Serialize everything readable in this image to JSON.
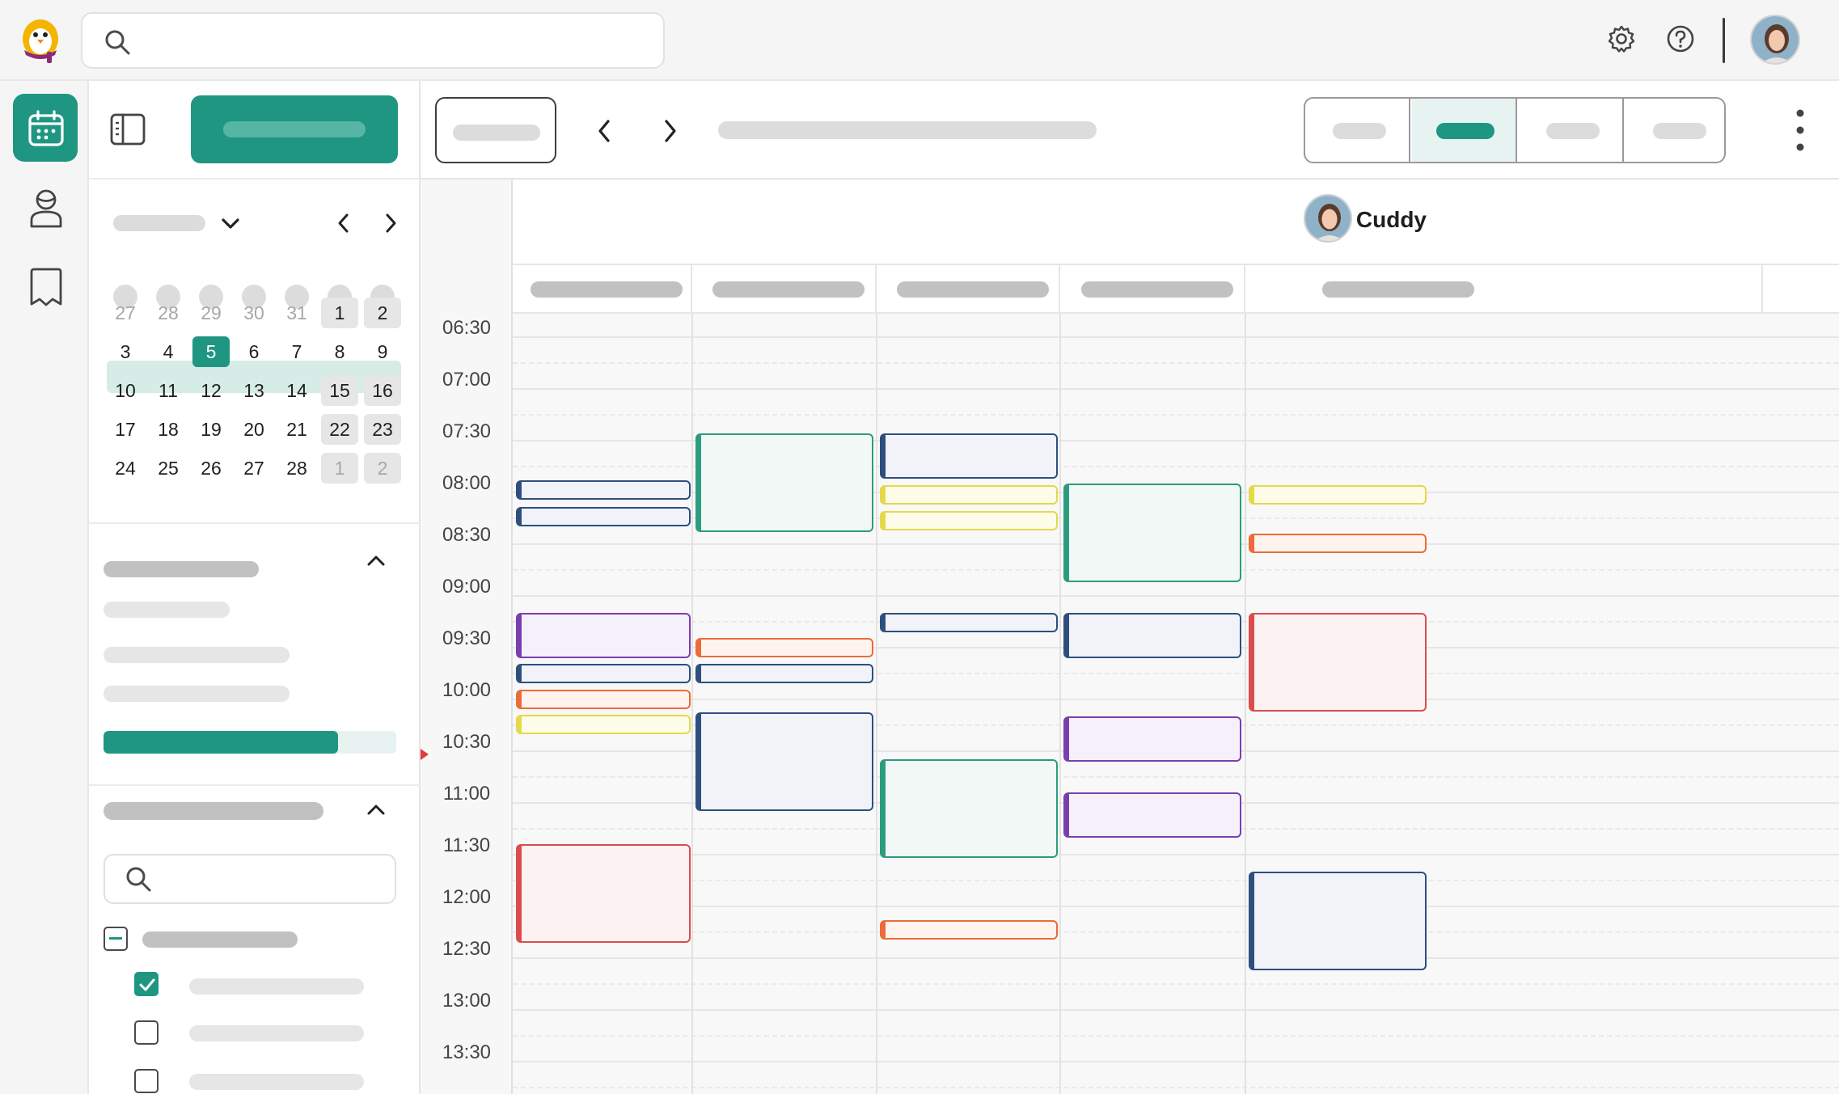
{
  "resource": {
    "name": "Dr. Cuddy"
  },
  "time_slots": [
    "06:30",
    "07:00",
    "07:30",
    "08:00",
    "08:30",
    "09:00",
    "09:30",
    "10:00",
    "10:30",
    "11:00",
    "11:30",
    "12:00",
    "12:30",
    "13:00",
    "13:30"
  ],
  "mini_calendar": {
    "weeks": [
      [
        "27",
        "28",
        "29",
        "30",
        "31",
        "1",
        "2"
      ],
      [
        "3",
        "4",
        "5",
        "6",
        "7",
        "8",
        "9"
      ],
      [
        "10",
        "11",
        "12",
        "13",
        "14",
        "15",
        "16"
      ],
      [
        "17",
        "18",
        "19",
        "20",
        "21",
        "22",
        "23"
      ],
      [
        "24",
        "25",
        "26",
        "27",
        "28",
        "1",
        "2"
      ]
    ],
    "selected_day": "5"
  },
  "colors": {
    "accent": "#1e9682",
    "event_green": "#2b9d7e",
    "event_blue": "#2e4f7e",
    "event_yellow": "#e4d94a",
    "event_orange": "#ec6b3a",
    "event_purple": "#7a3fae",
    "event_red": "#da4d4d"
  },
  "icons": {
    "logo": "penguin-logo-icon",
    "search": "search-icon",
    "settings": "gear-icon",
    "help": "help-icon",
    "calendar": "calendar-icon",
    "patients": "person-icon",
    "notes": "book-icon"
  },
  "progress": {
    "fill": 0.8
  }
}
